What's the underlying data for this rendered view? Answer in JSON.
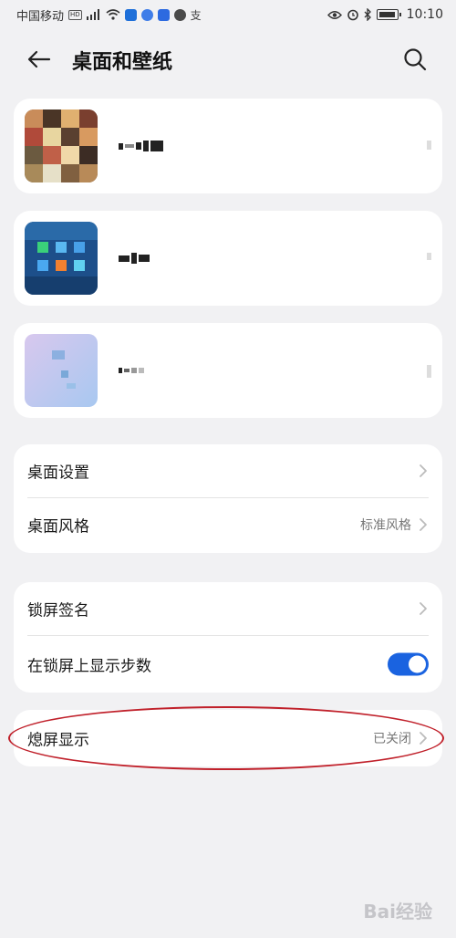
{
  "status_bar": {
    "carrier": "中国移动",
    "network_badge": "HD",
    "signal": "4G",
    "time": "10:10",
    "icons": [
      "signal-icon",
      "wifi-icon",
      "app-shield-icon",
      "app-blue-icon",
      "app-bag-icon",
      "app-globe-icon",
      "alipay-icon",
      "eye-icon",
      "alarm-icon",
      "bluetooth-icon",
      "battery-icon"
    ]
  },
  "header": {
    "title": "桌面和壁纸"
  },
  "themes": [
    {
      "name_obscured": true,
      "thumb_palette": "mosaic-warm"
    },
    {
      "name_obscured": true,
      "thumb_palette": "mosaic-blue"
    },
    {
      "name_obscured": true,
      "thumb_palette": "mosaic-pastel"
    }
  ],
  "desktop_group": {
    "desktop_settings": {
      "label": "桌面设置"
    },
    "desktop_style": {
      "label": "桌面风格",
      "value": "标准风格"
    }
  },
  "lock_group": {
    "lock_signature": {
      "label": "锁屏签名"
    },
    "show_steps": {
      "label": "在锁屏上显示步数",
      "enabled": true
    }
  },
  "aod_group": {
    "always_on_display": {
      "label": "熄屏显示",
      "value": "已关闭"
    }
  },
  "colors": {
    "background": "#f1f1f3",
    "card": "#ffffff",
    "accent": "#1a63e0",
    "annotation": "#c0202a"
  },
  "watermark": {
    "text": "Bai经验"
  }
}
